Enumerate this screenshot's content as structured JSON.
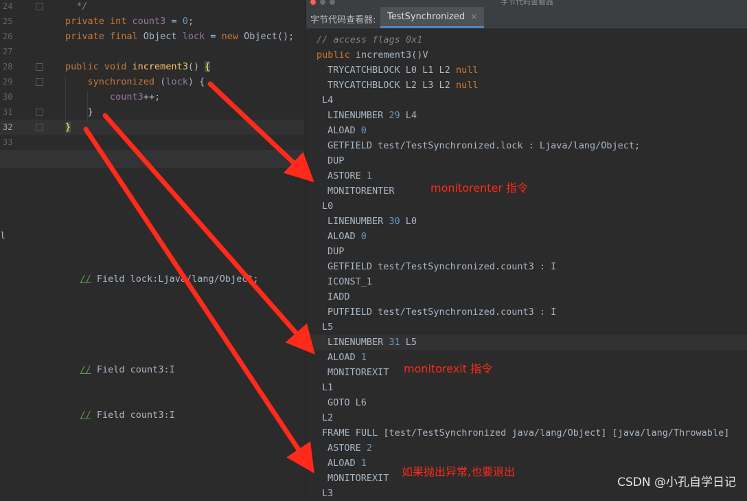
{
  "editor": {
    "lines": [
      {
        "num": "24",
        "html": "<span class='cm'>  */</span>"
      },
      {
        "num": "25",
        "html": "<span class='kw'>private int </span><span class='field'>count3</span> = <span class='num'>0</span>;"
      },
      {
        "num": "26",
        "html": "<span class='kw'>private final </span>Object <span class='field'>lock</span> = <span class='kw'>new </span>Object();"
      },
      {
        "num": "27",
        "html": ""
      },
      {
        "num": "28",
        "html": "<span class='kw'>public void </span><span class='fn'>increment3</span>() <span class='brace-hl'>{</span>"
      },
      {
        "num": "29",
        "html": "    <span class='kw'>synchronized </span>(<span class='field'>lock</span>) {"
      },
      {
        "num": "30",
        "html": "        <span class='field'>count3</span>++;"
      },
      {
        "num": "31",
        "html": "    }"
      },
      {
        "num": "32",
        "html": "<span class='brace-hl'>}</span>"
      },
      {
        "num": "33",
        "html": ""
      }
    ],
    "lower_comments": [
      {
        "slashes": "//",
        "text": " Field lock:Ljava/lang/Object;"
      },
      {
        "slashes": "//",
        "text": " Field count3:I"
      },
      {
        "slashes": "//",
        "text": " Field count3:I"
      }
    ],
    "edge_char": "l"
  },
  "viewer": {
    "window_title": "字节代码查看器",
    "tool_name": "字节代码查看器:",
    "tab_label": "TestSynchronized",
    "tab_close": "×",
    "bytecode": [
      {
        "indent": 0,
        "html": "<span class='cm'>// access flags 0x1</span>"
      },
      {
        "indent": 0,
        "html": "<span class='kw'>public </span>increment3()V"
      },
      {
        "indent": 2,
        "html": "TRYCATCHBLOCK L0 L1 L2 <span class='kw'>null</span>"
      },
      {
        "indent": 2,
        "html": "TRYCATCHBLOCK L2 L3 L2 <span class='kw'>null</span>"
      },
      {
        "indent": 1,
        "html": "L4"
      },
      {
        "indent": 2,
        "html": "LINENUMBER <span class='num'>29</span> L4"
      },
      {
        "indent": 2,
        "html": "ALOAD <span class='num'>0</span>"
      },
      {
        "indent": 2,
        "html": "GETFIELD test/TestSynchronized.lock : Ljava/lang/Object;"
      },
      {
        "indent": 2,
        "html": "DUP"
      },
      {
        "indent": 2,
        "html": "ASTORE <span class='num'>1</span>"
      },
      {
        "indent": 2,
        "html": "MONITORENTER"
      },
      {
        "indent": 1,
        "html": "L0"
      },
      {
        "indent": 2,
        "html": "LINENUMBER <span class='num'>30</span> L0"
      },
      {
        "indent": 2,
        "html": "ALOAD <span class='num'>0</span>"
      },
      {
        "indent": 2,
        "html": "DUP"
      },
      {
        "indent": 2,
        "html": "GETFIELD test/TestSynchronized.count3 : I"
      },
      {
        "indent": 2,
        "html": "ICONST_1"
      },
      {
        "indent": 2,
        "html": "IADD"
      },
      {
        "indent": 2,
        "html": "PUTFIELD test/TestSynchronized.count3 : I"
      },
      {
        "indent": 1,
        "html": "L5"
      },
      {
        "indent": 2,
        "html": "LINENUMBER <span class='num'>31</span> L5",
        "highlight": true
      },
      {
        "indent": 2,
        "html": "ALOAD <span class='num'>1</span>"
      },
      {
        "indent": 2,
        "html": "MONITOREXIT"
      },
      {
        "indent": 1,
        "html": "L1"
      },
      {
        "indent": 2,
        "html": "GOTO L6"
      },
      {
        "indent": 1,
        "html": "L2"
      },
      {
        "indent": 1,
        "html": "FRAME FULL [test/TestSynchronized java/lang/Object] [java/lang/Throwable]"
      },
      {
        "indent": 2,
        "html": "ASTORE <span class='num'>2</span>"
      },
      {
        "indent": 2,
        "html": "ALOAD <span class='num'>1</span>"
      },
      {
        "indent": 2,
        "html": "MONITOREXIT"
      },
      {
        "indent": 1,
        "html": "L3"
      }
    ]
  },
  "annotations": {
    "monitorenter": "monitorenter 指令",
    "monitorexit": "monitorexit 指令",
    "exception_exit": "如果抛出异常,也要退出",
    "color": "#ff2a1a"
  },
  "watermark": "CSDN @小孔自学日记"
}
